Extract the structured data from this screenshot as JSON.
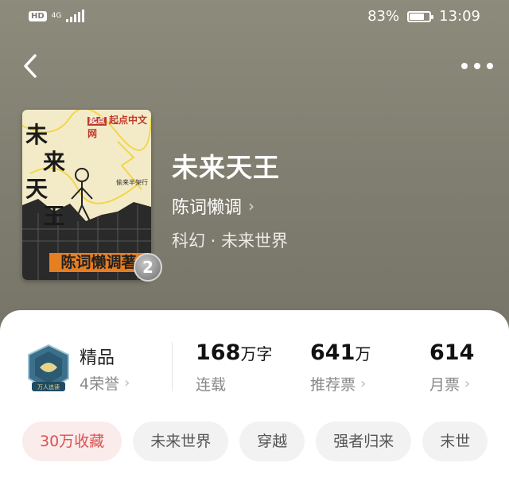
{
  "status_bar": {
    "hd": "HD",
    "network": "4G",
    "battery_percent": "83%",
    "battery_level": 0.83,
    "time": "13:09"
  },
  "nav": {
    "back_icon": "chevron-left-icon",
    "more_icon": "more-horizontal-icon"
  },
  "book": {
    "title": "未来天王",
    "author": "陈词懒调",
    "genre": "科幻 · 未来世界",
    "cover": {
      "logo_badge": "起点",
      "logo_text": "起点中文网",
      "title_chars": [
        "未",
        "来",
        "天",
        "王"
      ],
      "sub_text": "偷来半架行",
      "author_banner": "陈词懒调著",
      "badge_number": "2"
    }
  },
  "stats": {
    "honor": {
      "title": "精品",
      "sub": "4荣誉",
      "badge_caption": "万人追读"
    },
    "words": {
      "value": "168",
      "unit": "万字",
      "label": "连载"
    },
    "recommend": {
      "value": "641",
      "unit": "万",
      "label": "推荐票"
    },
    "monthly": {
      "value": "614",
      "label": "月票"
    }
  },
  "tags": [
    {
      "label": "30万收藏",
      "hot": true
    },
    {
      "label": "未来世界",
      "hot": false
    },
    {
      "label": "穿越",
      "hot": false
    },
    {
      "label": "强者归来",
      "hot": false
    },
    {
      "label": "末世",
      "hot": false
    }
  ],
  "colors": {
    "accent_red": "#d9534f",
    "cover_banner": "#e67e22"
  }
}
